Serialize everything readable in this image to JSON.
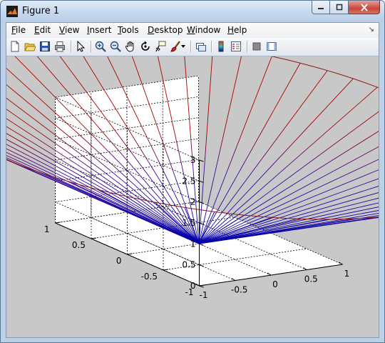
{
  "window": {
    "title": "Figure 1"
  },
  "menu": [
    {
      "pre": "",
      "u": "F",
      "post": "ile"
    },
    {
      "pre": "",
      "u": "E",
      "post": "dit"
    },
    {
      "pre": "",
      "u": "V",
      "post": "iew"
    },
    {
      "pre": "",
      "u": "I",
      "post": "nsert"
    },
    {
      "pre": "",
      "u": "T",
      "post": "ools"
    },
    {
      "pre": "",
      "u": "D",
      "post": "esktop"
    },
    {
      "pre": "",
      "u": "W",
      "post": "indow"
    },
    {
      "pre": "",
      "u": "H",
      "post": "elp"
    }
  ],
  "toolbar": {
    "icons": [
      "new-figure-icon",
      "open-file-icon",
      "save-icon",
      "print-icon",
      "edit-plot-arrow-icon",
      "zoom-in-icon",
      "zoom-out-icon",
      "pan-hand-icon",
      "rotate-3d-icon",
      "data-cursor-icon",
      "brush-icon",
      "brush-dropdown-icon",
      "link-plot-icon",
      "insert-colorbar-icon",
      "insert-legend-icon",
      "hide-plot-tools-icon",
      "show-plot-tools-icon"
    ]
  },
  "chart_data": {
    "type": "surface-mesh",
    "surface": "cone z = sqrt(x^2 + y^2)",
    "z_ticks": [
      "0",
      "0.5",
      "1",
      "1.5",
      "2",
      "2.5",
      "3"
    ],
    "y_ticks": [
      "1",
      "0.5",
      "0",
      "-0.5",
      "-1"
    ],
    "x_ticks": [
      "-1",
      "-0.5",
      "0",
      "0.5",
      "1"
    ],
    "xlim": [
      -1,
      1
    ],
    "ylim": [
      -1,
      1
    ],
    "zlim": [
      0,
      3
    ],
    "z_top": 2.8,
    "mesh_lines": 60,
    "grid": true,
    "colors": {
      "line_bottom": "#0000aa",
      "line_top": "#aa0000",
      "rim": "#8b1a1a"
    }
  },
  "colors": {
    "figure_bg": "#c8c8c8",
    "axes_bg": "#ffffff",
    "title_bar": "#c6d8ed"
  }
}
